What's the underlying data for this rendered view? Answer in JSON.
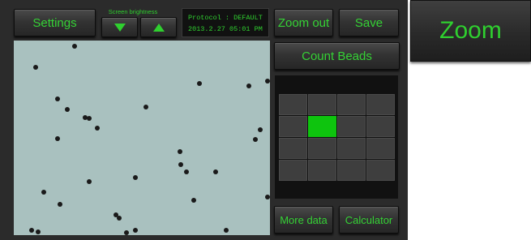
{
  "controls": {
    "settings_label": "Settings",
    "brightness_label": "Screen brightness",
    "brightness_down_icon": "triangle-down",
    "brightness_up_icon": "triangle-up",
    "zoom_out_label": "Zoom out",
    "save_label": "Save",
    "count_beads_label": "Count Beads",
    "more_data_label": "More data",
    "calculator_label": "Calculator"
  },
  "status": {
    "protocol": "Protocol : DEFAULT",
    "datetime": "2013.2.27 05:01 PM"
  },
  "region_grid": {
    "rows": 4,
    "cols": 4,
    "active_row": 1,
    "active_col": 1
  },
  "zoom_tile": {
    "label": "Zoom"
  },
  "colors": {
    "accent_green": "#2fd02f",
    "active_cell": "#0ec40e",
    "panel_bg": "#2b2b2b",
    "microscope_bg": "#a9c1bf",
    "bead": "#1a1a1a"
  },
  "microscope_view": {
    "content": "beads",
    "bead_count_visible": 36
  }
}
